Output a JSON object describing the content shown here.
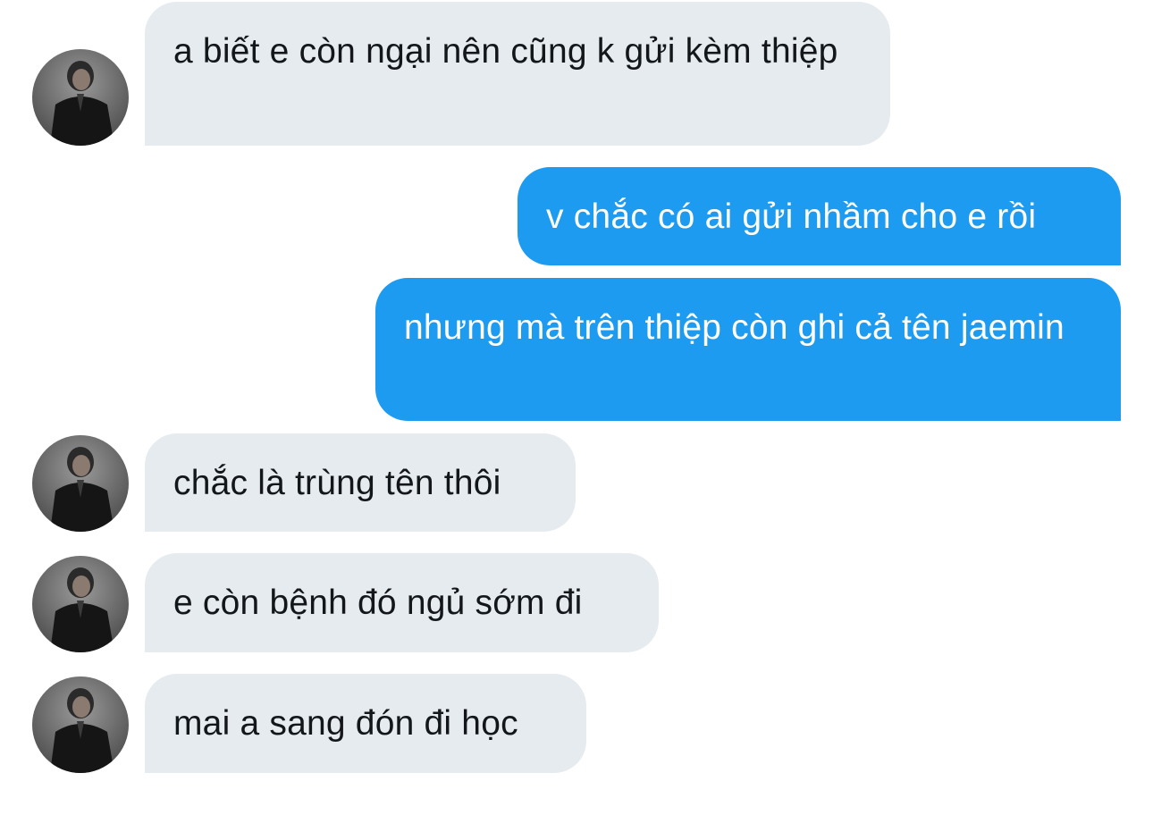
{
  "conversation": {
    "messages": [
      {
        "direction": "incoming",
        "text": "a biết e còn ngại nên cũng k gửi kèm thiệp",
        "avatar": "contact-avatar-icon"
      },
      {
        "direction": "outgoing",
        "text": "v chắc có ai gửi nhầm cho e rồi"
      },
      {
        "direction": "outgoing",
        "text": "nhưng mà trên thiệp còn ghi cả tên jaemin"
      },
      {
        "direction": "incoming",
        "text": "chắc là trùng tên thôi",
        "avatar": "contact-avatar-icon"
      },
      {
        "direction": "incoming",
        "text": "e còn bệnh đó ngủ sớm đi",
        "avatar": "contact-avatar-icon"
      },
      {
        "direction": "incoming",
        "text": "mai a sang đón đi học",
        "avatar": "contact-avatar-icon"
      }
    ]
  },
  "colors": {
    "incoming_bubble": "#e6ebef",
    "outgoing_bubble": "#1d9bf0",
    "incoming_text": "#14171a",
    "outgoing_text": "#ffffff"
  }
}
